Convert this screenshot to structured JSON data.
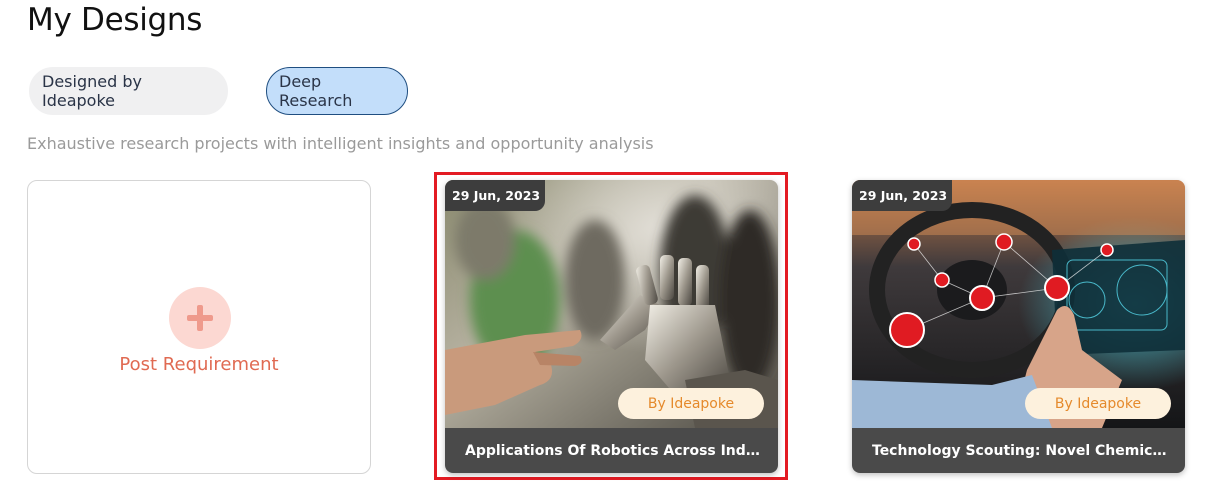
{
  "page": {
    "title": "My Designs"
  },
  "tabs": [
    {
      "label": "Designed by Ideapoke",
      "active": false
    },
    {
      "label": "Deep Research",
      "active": true
    }
  ],
  "subtitle": "Exhaustive research projects with intelligent insights and opportunity analysis",
  "post_card": {
    "label": "Post Requirement",
    "icon": "plus-icon"
  },
  "cards": [
    {
      "date": "29 Jun, 2023",
      "badge": "By Ideapoke",
      "title": "Applications Of Robotics Across Industries"
    },
    {
      "date": "29 Jun, 2023",
      "badge": "By Ideapoke",
      "title": "Technology Scouting: Novel Chemicals For..."
    }
  ],
  "colors": {
    "accent_tab_bg": "#c3defa",
    "post_text": "#e06a52",
    "badge_text": "#e58a2c",
    "highlight": "#e31b23"
  }
}
